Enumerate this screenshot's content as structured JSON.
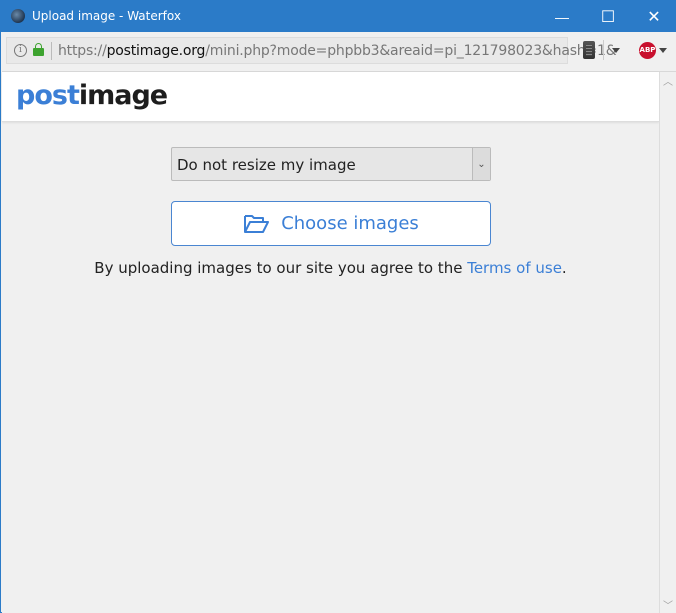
{
  "window": {
    "title": "Upload image - Waterfox",
    "controls": {
      "minimize": "—",
      "maximize": "☐",
      "close": "✕"
    }
  },
  "navbar": {
    "url_prefix": "https://",
    "url_host": "postimage.org",
    "url_path": "/mini.php?mode=phpbb3&areaid=pi_121798023&hash=1&",
    "info_icon": "i",
    "abp_label": "ABP"
  },
  "page": {
    "logo_part1": "post",
    "logo_part2": "image",
    "resize_select": {
      "selected": "Do not resize my image",
      "arrow": "⌄"
    },
    "choose_button": "Choose images",
    "terms_text": "By uploading images to our site you agree to the ",
    "terms_link": "Terms of use",
    "terms_end": "."
  },
  "scrollbar": {
    "up": "︿",
    "down": "﹀"
  },
  "colors": {
    "titlebar": "#2b7bc8",
    "accent": "#3b7fd6",
    "lock": "#3da32f",
    "abp": "#c8102e"
  }
}
